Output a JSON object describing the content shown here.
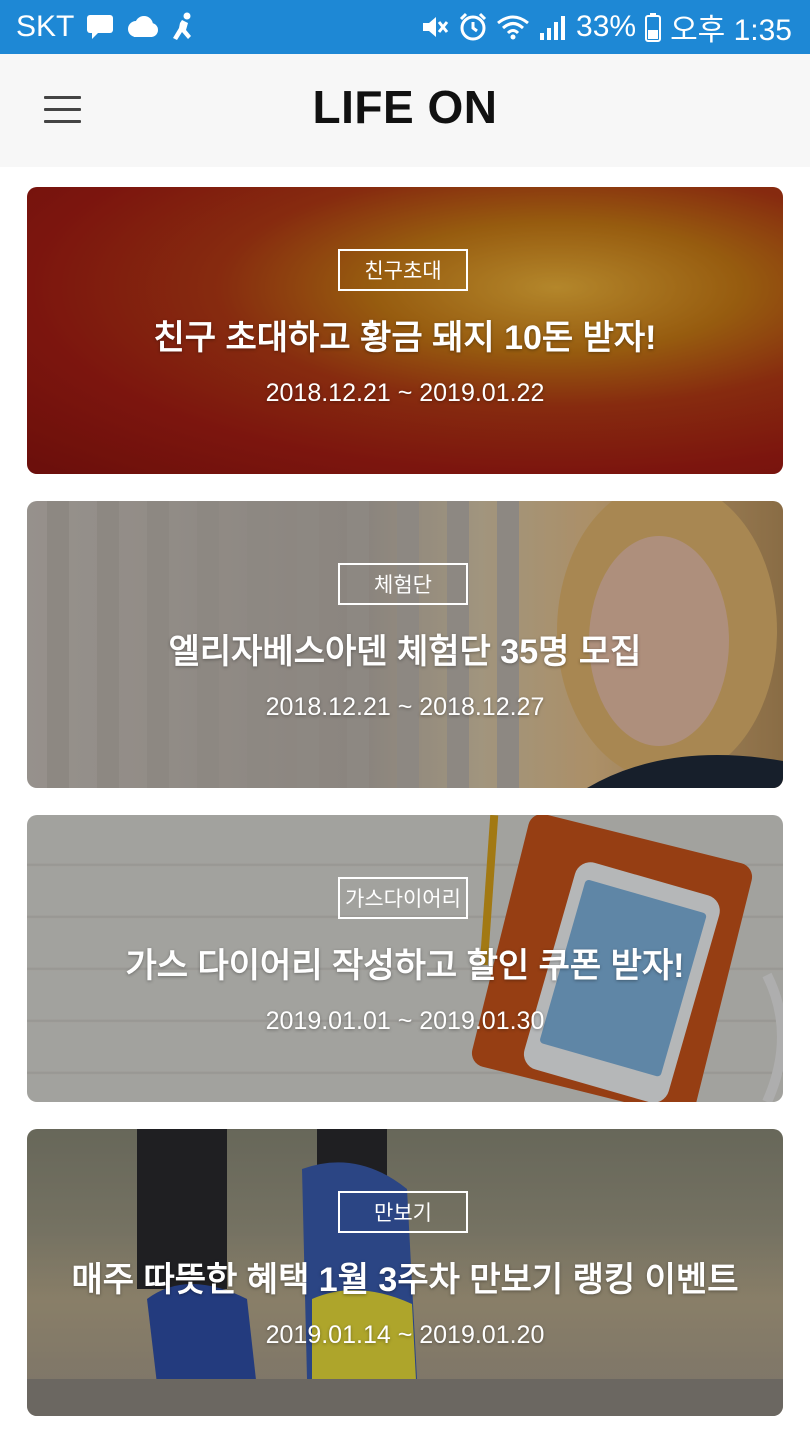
{
  "status_bar": {
    "carrier": "SKT",
    "battery": "33%",
    "time": "오후 1:35",
    "icons": [
      "message-icon",
      "cloud-icon",
      "runner-icon",
      "mute-icon",
      "alarm-icon",
      "wifi-icon",
      "signal-icon",
      "battery-icon"
    ]
  },
  "header": {
    "title": "LIFE ON",
    "menu_icon": "hamburger-menu-icon"
  },
  "events": [
    {
      "tag": "친구초대",
      "title": "친구 초대하고 황금 돼지 10돈 받자!",
      "period": "2018.12.21 ~ 2019.01.22"
    },
    {
      "tag": "체험단",
      "title": "엘리자베스아덴 체험단 35명 모집",
      "period": "2018.12.21 ~ 2018.12.27"
    },
    {
      "tag": "가스다이어리",
      "title": "가스 다이어리 작성하고 할인 쿠폰 받자!",
      "period": "2019.01.01 ~ 2019.01.30"
    },
    {
      "tag": "만보기",
      "title": "매주 따뜻한 혜택 1월 3주차 만보기 랭킹 이벤트",
      "period": "2019.01.14 ~ 2019.01.20"
    }
  ],
  "colors": {
    "status_bar": "#1e88d5",
    "header_bg": "#f7f7f7",
    "title_text": "#111111"
  }
}
